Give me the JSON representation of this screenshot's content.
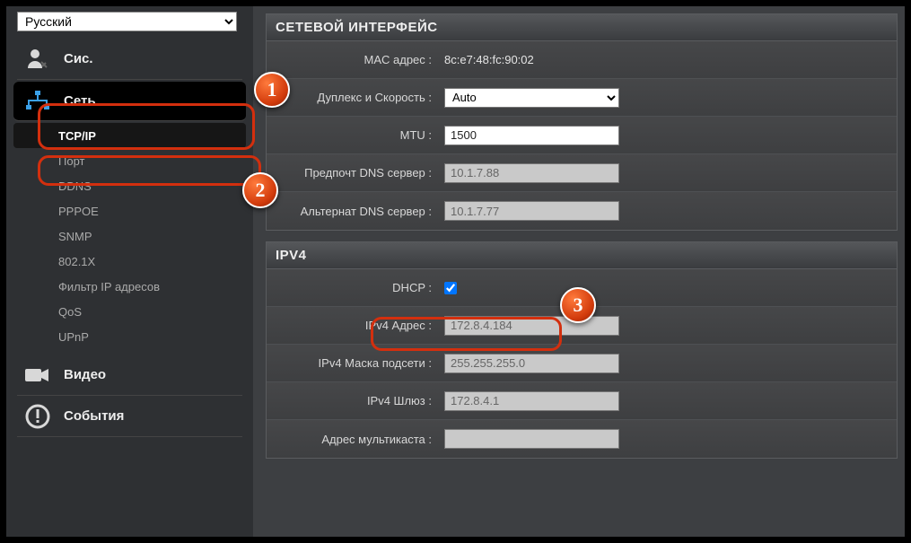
{
  "lang": {
    "selected": "Русский"
  },
  "sidebar": {
    "system": "Сис.",
    "network": "Сеть",
    "sub": [
      "TCP/IP",
      "Порт",
      "DDNS",
      "PPPOE",
      "SNMP",
      "802.1X",
      "Фильтр IP адресов",
      "QoS",
      "UPnP"
    ],
    "video": "Видео",
    "events": "События"
  },
  "panel1": {
    "title": "СЕТЕВОЙ ИНТЕРФЕЙС",
    "mac_label": "MAC адрес :",
    "mac_value": "8c:e7:48:fc:90:02",
    "duplex_label": "Дуплекс и Скорость :",
    "duplex_value": "Auto",
    "mtu_label": "MTU :",
    "mtu_value": "1500",
    "dns1_label": "Предпочт DNS сервер :",
    "dns1_value": "10.1.7.88",
    "dns2_label": "Альтернат DNS сервер :",
    "dns2_value": "10.1.7.77"
  },
  "panel2": {
    "title": "IPV4",
    "dhcp_label": "DHCP :",
    "dhcp_checked": true,
    "ip_label": "IPv4 Адрес :",
    "ip_value": "172.8.4.184",
    "mask_label": "IPv4 Маска подсети :",
    "mask_value": "255.255.255.0",
    "gw_label": "IPv4 Шлюз :",
    "gw_value": "172.8.4.1",
    "mc_label": "Адрес мультикаста :",
    "mc_value": ""
  },
  "badges": {
    "b1": "1",
    "b2": "2",
    "b3": "3"
  }
}
